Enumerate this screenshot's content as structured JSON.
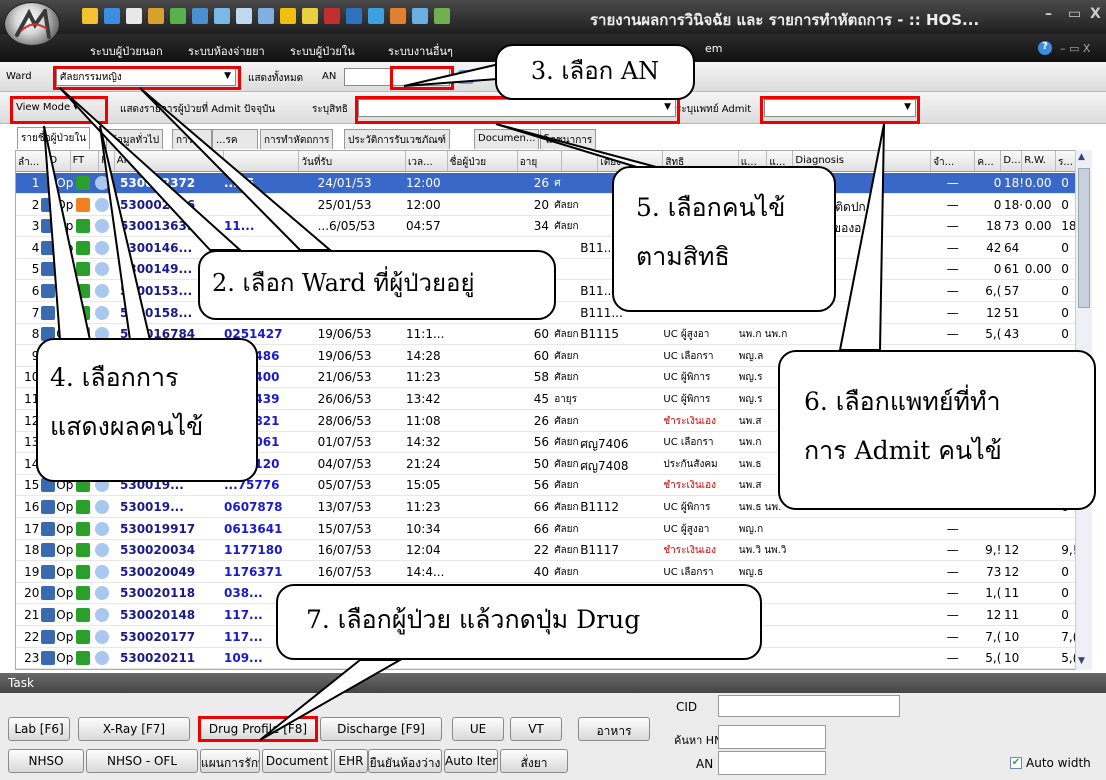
{
  "window": {
    "title": "รายงานผลการวินิจฉัย และ รายการทำหัตถการ - :: HOS...",
    "min": "–",
    "max": "▭",
    "close": "X"
  },
  "menubar": {
    "items": [
      "ระบบผู้ป่วยนอก",
      "ระบบห้องจ่ายยา",
      "ระบบผู้ป่วยใน",
      "ระบบงานอื่นๆ",
      "em"
    ],
    "help": "?",
    "controls": "– ▭ X"
  },
  "toolbar1": {
    "ward_label": "Ward",
    "ward_value": "ศัลยกรรมหญิง",
    "show_all": "แสดงทั้งหมด",
    "an_label": "AN",
    "an_value": ""
  },
  "toolbar2": {
    "view_mode": "View Mode",
    "show_current": "แสดงรายการผู้ป่วยที่ Admit ปัจจุบัน",
    "rights_label": "ระบุสิทธิ",
    "rights_value": "",
    "doctor_label": "ระบุแพทย์ Admit",
    "doctor_value": ""
  },
  "tabs": [
    "รายชื่อผู้ป่วยใน",
    "ข้อมูลทั่วไป",
    "การ...",
    "...รค",
    "การทำหัตถการ",
    "ประวัติการรับเวชภัณฑ์",
    "Documen...",
    "โภชนาการ"
  ],
  "columns": [
    "ลำ...",
    "O",
    "FT",
    "F.",
    "AN",
    "",
    "วันที่รับ",
    "เวล...",
    "ชื่อผู้ป่วย",
    "อายุ",
    "",
    "เตียง",
    "สิทธิ",
    "แ...",
    "แ...",
    "Diagnosis",
    "จำ...",
    "ค...",
    "D...",
    "R.W.",
    "ร...",
    "ชำ..."
  ],
  "rows": [
    {
      "no": "1",
      "op": "Op",
      "an": "530002372",
      "hn": "...85",
      "date": "24/01/53",
      "time": "12:00",
      "age": "26",
      "ward": "ศ",
      "bed": "",
      "right": "",
      "doc": "",
      "diag": "Cellu",
      "dash": "—",
      "c1": "0",
      "c2": "18!",
      "rw": "0.00",
      "c3": "0",
      "c4": "0",
      "sel": true,
      "ft": "green"
    },
    {
      "no": "2",
      "op": "Op",
      "an": "530002526",
      "hn": "",
      "date": "25/01/53",
      "time": "12:00",
      "age": "20",
      "ward": "ศัลยก",
      "bed": "",
      "right": "",
      "doc": "",
      "diag": "- กล้ ... ติดปก",
      "dash": "—",
      "c1": "0",
      "c2": "18·",
      "rw": "0.00",
      "c3": "0",
      "c4": "0",
      "sel": false,
      "ft": "orange"
    },
    {
      "no": "3",
      "op": "Op",
      "an": "530013639",
      "hn": "11...",
      "date": "...6/05/53",
      "time": "04:57",
      "age": "34",
      "ward": "ศัลยก",
      "bed": "",
      "right": "",
      "doc": "",
      "diag": "การ ... ของอ",
      "dash": "—",
      "c1": "18",
      "c2": "73",
      "rw": "0.00",
      "c3": "18",
      "c4": "0",
      "sel": false,
      "ft": "green"
    },
    {
      "no": "4",
      "op": "Op",
      "an": "5300146...",
      "hn": "",
      "date": "",
      "time": "",
      "age": "",
      "ward": "",
      "bed": "B11...",
      "right": "",
      "doc": "",
      "diag": "",
      "dash": "—",
      "c1": "42",
      "c2": "64",
      "rw": "",
      "c3": "0",
      "c4": "0",
      "sel": false,
      "ft": "green"
    },
    {
      "no": "5",
      "op": "Op",
      "an": "5300149...",
      "hn": "",
      "date": "",
      "time": "",
      "age": "",
      "ward": "",
      "bed": "",
      "right": "",
      "doc": "",
      "diag": "ial",
      "dash": "—",
      "c1": "0",
      "c2": "61",
      "rw": "0.00",
      "c3": "0",
      "c4": "0",
      "sel": false,
      "ft": "green"
    },
    {
      "no": "6",
      "op": "Op",
      "an": "5300153...",
      "hn": "",
      "date": "",
      "time": "",
      "age": "",
      "ward": "",
      "bed": "B11...",
      "right": "",
      "doc": "",
      "diag": "",
      "dash": "—",
      "c1": "6,(",
      "c2": "57",
      "rw": "",
      "c3": "0",
      "c4": "0",
      "sel": false,
      "ft": "green"
    },
    {
      "no": "7",
      "op": "Op",
      "an": "5300158...",
      "hn": "",
      "date": "",
      "time": "",
      "age": "",
      "ward": "",
      "bed": "B111...",
      "right": "",
      "doc": "",
      "diag": "",
      "dash": "—",
      "c1": "12",
      "c2": "51",
      "rw": "",
      "c3": "0",
      "c4": "0",
      "sel": false,
      "ft": "green"
    },
    {
      "no": "8",
      "op": "Op",
      "an": "530016784",
      "hn": "0251427",
      "date": "19/06/53",
      "time": "11:1...",
      "age": "60",
      "ward": "ศัลยก",
      "bed": "B1115",
      "right": "UC ผู้สูงอา",
      "doc": "นพ.ก นพ.ก",
      "diag": "",
      "dash": "—",
      "c1": "5,(",
      "c2": "43",
      "rw": "",
      "c3": "0",
      "c4": "0",
      "sel": false,
      "ft": "green"
    },
    {
      "no": "9",
      "op": "Op",
      "an": "530016...",
      "hn": "...88486",
      "date": "19/06/53",
      "time": "14:28",
      "age": "60",
      "ward": "ศัลยก",
      "bed": "",
      "right": "UC เลือกรา",
      "doc": "พญ.ล",
      "diag": "",
      "dash": "—",
      "c1": "6,(",
      "c2": "39",
      "rw": "",
      "c3": "0",
      "c4": "0",
      "sel": false,
      "ft": "green"
    },
    {
      "no": "10",
      "op": "Op",
      "an": "530017...",
      "hn": "...08400",
      "date": "21/06/53",
      "time": "11:23",
      "age": "58",
      "ward": "ศัลยก",
      "bed": "",
      "right": "UC ผู้พิการ",
      "doc": "พญ.ร",
      "diag": "",
      "dash": "—",
      "c1": "",
      "c2": "",
      "rw": "",
      "c3": "0",
      "c4": "0",
      "sel": false,
      "ft": "green"
    },
    {
      "no": "11",
      "op": "Op",
      "an": "530017...",
      "hn": "...51439",
      "date": "26/06/53",
      "time": "13:42",
      "age": "45",
      "ward": "อายุร",
      "bed": "",
      "right": "UC ผู้พิการ",
      "doc": "พญ.ร",
      "diag": "",
      "dash": "—",
      "c1": "",
      "c2": "",
      "rw": "",
      "c3": "0",
      "c4": "0",
      "sel": false,
      "ft": "green"
    },
    {
      "no": "12",
      "op": "Op",
      "an": "530017...",
      "hn": "...74821",
      "date": "28/06/53",
      "time": "11:08",
      "age": "26",
      "ward": "ศัลยก",
      "bed": "",
      "right": "ชำระเงินเอง",
      "doc": "นพ.ส",
      "diag": "",
      "dash": "—",
      "c1": "",
      "c2": "",
      "rw": "",
      "c3": "0",
      "c4": "0",
      "sel": false,
      "ft": "green",
      "red": true
    },
    {
      "no": "13",
      "op": "Op",
      "an": "530018...",
      "hn": "...22061",
      "date": "01/07/53",
      "time": "14:32",
      "age": "56",
      "ward": "ศัลยก",
      "bed": "ศญ7406",
      "right": "UC เลือกรา",
      "doc": "นพ.ก",
      "diag": "",
      "dash": "—",
      "c1": "",
      "c2": "",
      "rw": "",
      "c3": "0",
      "c4": "0",
      "sel": false,
      "ft": "green"
    },
    {
      "no": "14",
      "op": "Op",
      "an": "530018...",
      "hn": "...78120",
      "date": "04/07/53",
      "time": "21:24",
      "age": "50",
      "ward": "ศัลยก",
      "bed": "ศญ7408",
      "right": "ประกันสังคม",
      "doc": "นพ.ธ",
      "diag": "",
      "dash": "—",
      "c1": "",
      "c2": "",
      "rw": "",
      "c3": "0",
      "c4": "0",
      "sel": false,
      "ft": "green"
    },
    {
      "no": "15",
      "op": "Op",
      "an": "530019...",
      "hn": "...75776",
      "date": "05/07/53",
      "time": "15:05",
      "age": "56",
      "ward": "ศัลยก",
      "bed": "",
      "right": "ชำระเงินเอง",
      "doc": "นพ.ส",
      "diag": "",
      "dash": "—",
      "c1": "",
      "c2": "",
      "rw": "",
      "c3": "0",
      "c4": "0",
      "sel": false,
      "ft": "green",
      "red": true
    },
    {
      "no": "16",
      "op": "Op",
      "an": "530019...",
      "hn": "0607878",
      "date": "13/07/53",
      "time": "11:23",
      "age": "66",
      "ward": "ศัลยก",
      "bed": "B1112",
      "right": "UC ผู้พิการ",
      "doc": "นพ.ธ นพ.",
      "diag": "",
      "dash": "—",
      "c1": "",
      "c2": "",
      "rw": "",
      "c3": "0",
      "c4": "0",
      "sel": false,
      "ft": "green"
    },
    {
      "no": "17",
      "op": "Op",
      "an": "530019917",
      "hn": "0613641",
      "date": "15/07/53",
      "time": "10:34",
      "age": "66",
      "ward": "ศัลยก",
      "bed": "",
      "right": "UC ผู้สูงอา",
      "doc": "พญ.ก",
      "diag": "",
      "dash": "—",
      "c1": "",
      "c2": "",
      "rw": "",
      "c3": "",
      "c4": "0",
      "sel": false,
      "ft": "green"
    },
    {
      "no": "18",
      "op": "Op",
      "an": "530020034",
      "hn": "1177180",
      "date": "16/07/53",
      "time": "12:04",
      "age": "22",
      "ward": "ศัลยก",
      "bed": "B1117",
      "right": "ชำระเงินเอง",
      "doc": "นพ.วิ นพ.วิ",
      "diag": "",
      "dash": "—",
      "c1": "9,!",
      "c2": "12",
      "rw": "",
      "c3": "9,!",
      "c4": "0",
      "sel": false,
      "ft": "green",
      "red": true
    },
    {
      "no": "19",
      "op": "Op",
      "an": "530020049",
      "hn": "1176371",
      "date": "16/07/53",
      "time": "14:4...",
      "age": "40",
      "ward": "ศัลยก",
      "bed": "",
      "right": "UC เลือกรา",
      "doc": "พญ.ธ",
      "diag": "",
      "dash": "—",
      "c1": "73",
      "c2": "12",
      "rw": "",
      "c3": "0",
      "c4": "0",
      "sel": false,
      "ft": "green"
    },
    {
      "no": "20",
      "op": "Op",
      "an": "530020118",
      "hn": "038...",
      "date": "",
      "time": "",
      "age": "",
      "ward": "",
      "bed": "",
      "right": "",
      "doc": "",
      "diag": "",
      "dash": "—",
      "c1": "1,(",
      "c2": "11",
      "rw": "",
      "c3": "0",
      "c4": "0",
      "sel": false,
      "ft": "green"
    },
    {
      "no": "21",
      "op": "Op",
      "an": "530020148",
      "hn": "117...",
      "date": "",
      "time": "",
      "age": "",
      "ward": "",
      "bed": "",
      "right": "",
      "doc": "",
      "diag": "",
      "dash": "—",
      "c1": "12",
      "c2": "11",
      "rw": "",
      "c3": "0",
      "c4": "0",
      "sel": false,
      "ft": "green"
    },
    {
      "no": "22",
      "op": "Op",
      "an": "530020177",
      "hn": "117...",
      "date": "",
      "time": "",
      "age": "",
      "ward": "",
      "bed": "",
      "right": "",
      "doc": "",
      "diag": "",
      "dash": "—",
      "c1": "7,(",
      "c2": "10",
      "rw": "",
      "c3": "7,(",
      "c4": "0",
      "sel": false,
      "ft": "green"
    },
    {
      "no": "23",
      "op": "Op",
      "an": "530020211",
      "hn": "109...",
      "date": "",
      "time": "",
      "age": "",
      "ward": "",
      "bed": "",
      "right": "",
      "doc": "",
      "diag": "",
      "dash": "—",
      "c1": "5,(",
      "c2": "10",
      "rw": "",
      "c3": "5,(",
      "c4": "0",
      "sel": false,
      "ft": "green"
    }
  ],
  "task": {
    "header": "Task",
    "row1": [
      "Lab [F6]",
      "X-Ray [F7]",
      "Drug Profile [F8]",
      "Discharge [F9]",
      "UE",
      "VT",
      "อาหาร"
    ],
    "row2": [
      "NHSO",
      "NHSO - OFL",
      "แผนการรักษา",
      "Document",
      "EHR",
      "ยืนยันห้องว่าง",
      "Auto Item",
      "สั่งยา"
    ],
    "cid_label": "CID",
    "hn_label": "ค้นหา HN",
    "an_label": "AN",
    "auto_width": "Auto width"
  },
  "callouts": {
    "c2": "2. เลือก Ward ที่ผู้ป่วยอยู่",
    "c3": "3. เลือก AN",
    "c4a": "4. เลือกการ",
    "c4b": "แสดงผลคนไข้",
    "c5a": "5. เลือกคนไข้",
    "c5b": "ตามสิทธิ",
    "c6a": "6. เลือกแพทย์ที่ทำ",
    "c6b": "การ Admit คนไข้",
    "c7": "7. เลือกผู้ป่วย แล้วกดปุ่ม  Drug"
  },
  "colors": {
    "selection": "#3a68c8",
    "annotation_red": "#e00000",
    "title_bar": "#2b2b2b"
  }
}
